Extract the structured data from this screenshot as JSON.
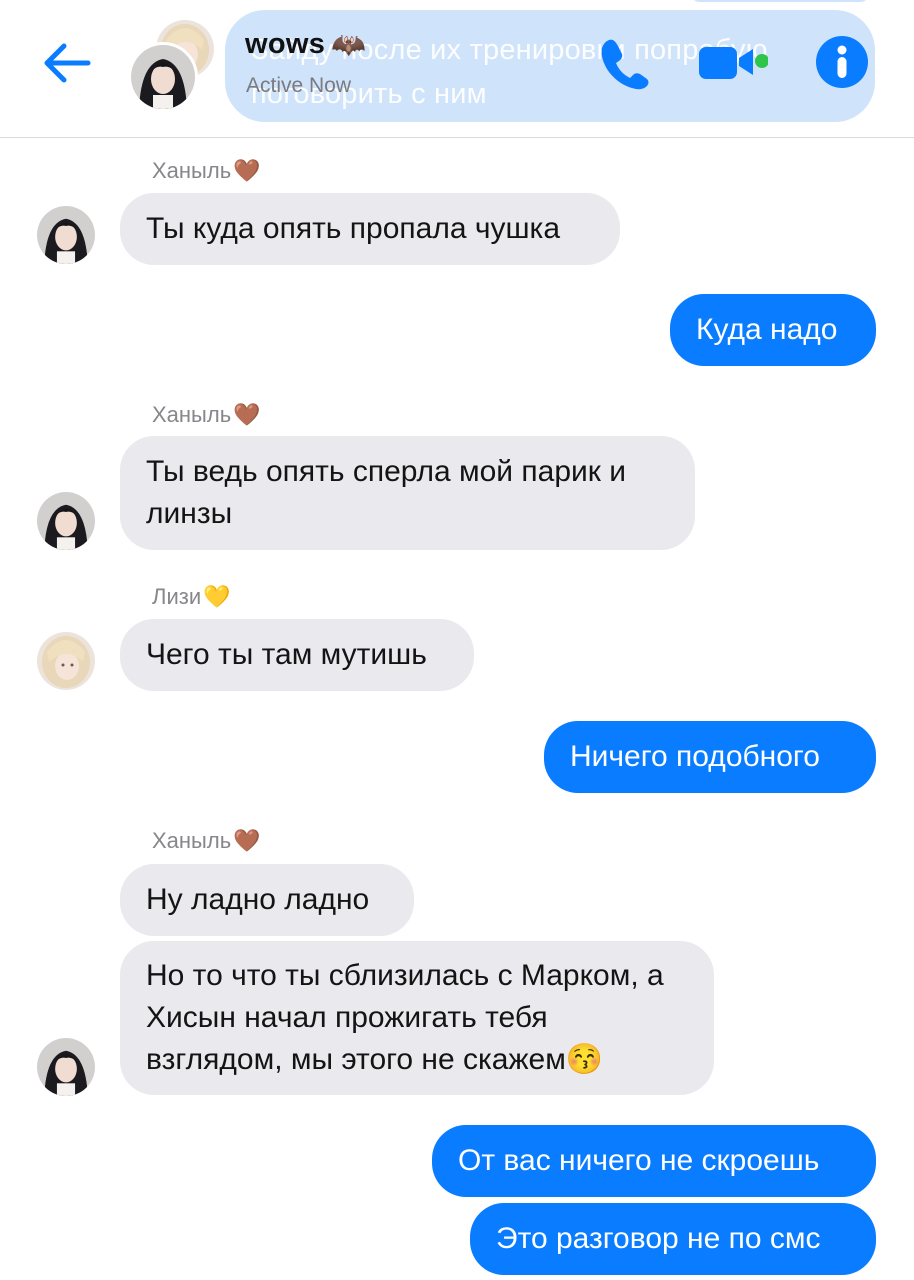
{
  "header": {
    "title": "wows",
    "title_emoji": "🦇",
    "status": "Active Now",
    "back_icon": "arrow-left-icon",
    "call_icon": "phone-icon",
    "video_icon": "video-camera-icon",
    "info_icon": "info-icon",
    "online_color": "#2fc44a",
    "accent": "#0a7cff",
    "behind_text": "Зайду после их тренировки попробую поговорить с ним"
  },
  "messages": [
    {
      "direction": "in",
      "sender": "Ханыль",
      "sender_emoji": "🤎",
      "text": "Ты куда опять пропала чушка"
    },
    {
      "direction": "out",
      "text": "Куда надо"
    },
    {
      "direction": "in",
      "sender": "Ханыль",
      "sender_emoji": "🤎",
      "text": "Ты ведь опять сперла мой парик и линзы"
    },
    {
      "direction": "in",
      "sender": "Лизи",
      "sender_emoji": "💛",
      "text": "Чего ты там мутишь"
    },
    {
      "direction": "out",
      "text": "Ничего подобного"
    },
    {
      "direction": "in",
      "sender": "Ханыль",
      "sender_emoji": "🤎",
      "text": "Ну ладно ладно"
    },
    {
      "direction": "in",
      "text": "Но то что ты сблизилась с Марком, а Хисын начал прожигать тебя взглядом, мы этого не скажем😚"
    },
    {
      "direction": "out",
      "text": "От вас ничего не скроешь"
    },
    {
      "direction": "out",
      "text": "Это разговор не по смс"
    }
  ],
  "colors": {
    "incoming_bubble": "#e9e9ee",
    "outgoing_bubble": "#0a7cff",
    "sender_name": "#86868b"
  }
}
